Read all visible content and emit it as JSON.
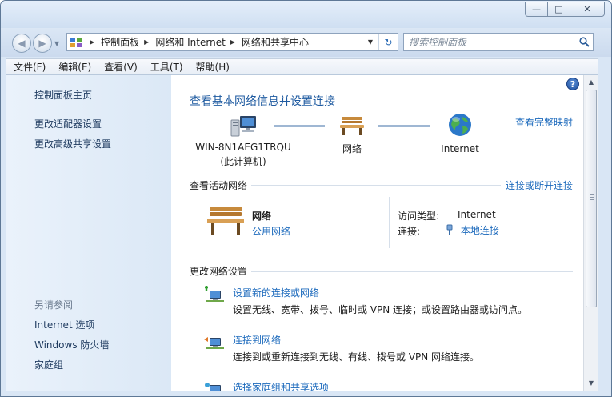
{
  "window": {
    "caption_buttons": {
      "minimize": "—",
      "maximize": "□",
      "close": "✕"
    }
  },
  "nav": {
    "back_glyph": "◀",
    "forward_glyph": "▶",
    "recent_glyph": "▼",
    "breadcrumbs": [
      "控制面板",
      "网络和 Internet",
      "网络和共享中心"
    ],
    "refresh_glyph": "↻",
    "search_placeholder": "搜索控制面板"
  },
  "menubar": {
    "items": [
      "文件(F)",
      "编辑(E)",
      "查看(V)",
      "工具(T)",
      "帮助(H)"
    ]
  },
  "sidebar": {
    "links": [
      "控制面板主页",
      "更改适配器设置",
      "更改高级共享设置"
    ],
    "see_also_header": "另请参阅",
    "see_also_links": [
      "Internet 选项",
      "Windows 防火墙",
      "家庭组"
    ]
  },
  "content": {
    "help_glyph": "?",
    "title": "查看基本网络信息并设置连接",
    "full_map_link": "查看完整映射",
    "map": {
      "computer_name": "WIN-8N1AEG1TRQU",
      "computer_sub": "(此计算机)",
      "network_label": "网络",
      "internet_label": "Internet"
    },
    "active_networks": {
      "header": "查看活动网络",
      "connect_link": "连接或断开连接",
      "network_name": "网络",
      "network_type": "公用网络",
      "access_type_label": "访问类型:",
      "access_type_value": "Internet",
      "connections_label": "连接:",
      "connections_value": "本地连接"
    },
    "change_settings": {
      "header": "更改网络设置",
      "tasks": [
        {
          "title": "设置新的连接或网络",
          "desc": "设置无线、宽带、拨号、临时或 VPN 连接；或设置路由器或访问点。",
          "icon": "new-connection-icon"
        },
        {
          "title": "连接到网络",
          "desc": "连接到或重新连接到无线、有线、拨号或 VPN 网络连接。",
          "icon": "connect-network-icon"
        },
        {
          "title": "选择家庭组和共享选项",
          "desc": "",
          "icon": "homegroup-icon"
        }
      ]
    }
  },
  "scrollbar": {
    "up_glyph": "▲",
    "down_glyph": "▼"
  }
}
